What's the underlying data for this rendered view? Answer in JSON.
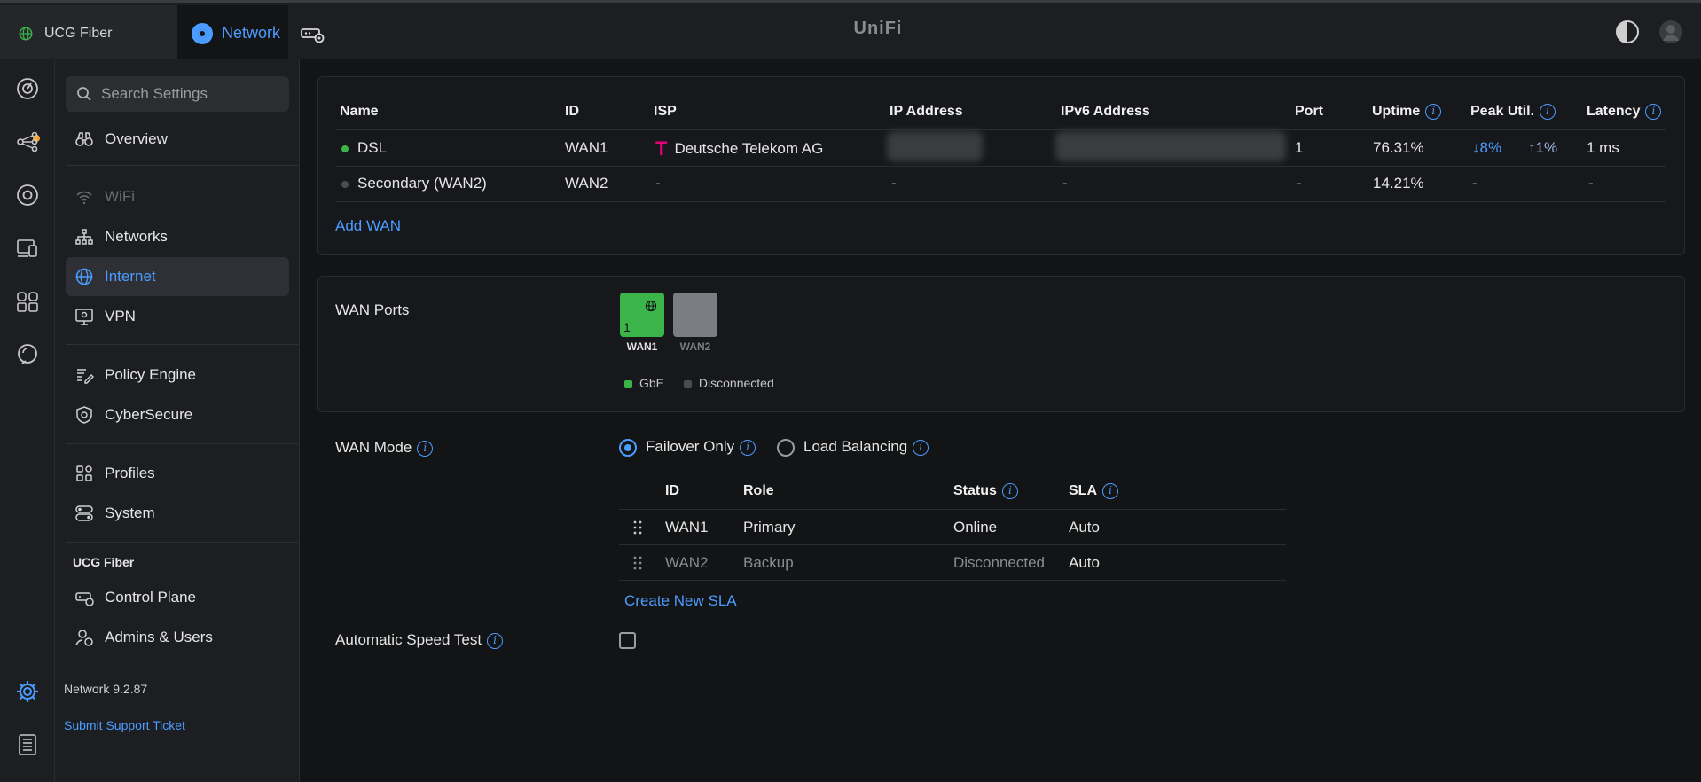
{
  "topbar": {
    "site_tab": "UCG Fiber",
    "app_tab": "Network",
    "brand": "UniFi"
  },
  "sidebar": {
    "search_placeholder": "Search Settings",
    "items": [
      {
        "label": "Overview",
        "icon": "binoculars-icon"
      },
      {
        "label": "WiFi",
        "icon": "wifi-icon",
        "disabled": true
      },
      {
        "label": "Networks",
        "icon": "network-tree-icon"
      },
      {
        "label": "Internet",
        "icon": "globe-icon",
        "active": true
      },
      {
        "label": "VPN",
        "icon": "vpn-icon"
      },
      {
        "label": "Policy Engine",
        "icon": "policy-icon"
      },
      {
        "label": "CyberSecure",
        "icon": "shield-icon"
      },
      {
        "label": "Profiles",
        "icon": "profiles-icon"
      },
      {
        "label": "System",
        "icon": "system-toggles-icon"
      }
    ],
    "section_label": "UCG Fiber",
    "device_items": [
      {
        "label": "Control Plane",
        "icon": "control-plane-icon"
      },
      {
        "label": "Admins & Users",
        "icon": "admins-icon"
      }
    ],
    "version": "Network 9.2.87",
    "support": "Submit Support Ticket"
  },
  "wan_table": {
    "headers": [
      "Name",
      "ID",
      "ISP",
      "IP Address",
      "IPv6 Address",
      "Port",
      "Uptime",
      "Peak Util.",
      "Latency"
    ],
    "rows": [
      {
        "name": "DSL",
        "status_color": "#3bb54a",
        "id": "WAN1",
        "isp": "Deutsche Telekom AG",
        "isp_logo": "T",
        "port": "1",
        "uptime": "76.31%",
        "peak_down": "↓8%",
        "peak_up": "↑1%",
        "latency": "1 ms"
      },
      {
        "name": "Secondary (WAN2)",
        "status_color": "#4a4c50",
        "id": "WAN2",
        "isp": "-",
        "ip": "-",
        "ipv6": "-",
        "port": "-",
        "uptime": "14.21%",
        "peak": "-",
        "latency": "-"
      }
    ],
    "add_wan": "Add WAN"
  },
  "wan_ports": {
    "label": "WAN Ports",
    "ports": [
      {
        "number": "1",
        "label": "WAN1",
        "color": "#3bb54a"
      },
      {
        "label": "WAN2",
        "color": "#7b7d82"
      }
    ],
    "legend": [
      {
        "label": "GbE",
        "color": "#3bb54a"
      },
      {
        "label": "Disconnected",
        "color": "#4a4c50"
      }
    ]
  },
  "wan_mode": {
    "label": "WAN Mode",
    "options": [
      {
        "label": "Failover Only",
        "selected": true
      },
      {
        "label": "Load Balancing",
        "selected": false
      }
    ],
    "table_headers": [
      "ID",
      "Role",
      "Status",
      "SLA"
    ],
    "rows": [
      {
        "id": "WAN1",
        "role": "Primary",
        "status": "Online",
        "sla": "Auto"
      },
      {
        "id": "WAN2",
        "role": "Backup",
        "status": "Disconnected",
        "sla": "Auto"
      }
    ],
    "create_sla": "Create New SLA"
  },
  "speed_test": {
    "label": "Automatic Speed Test",
    "checked": false
  },
  "colors": {
    "accent": "#4c9cff",
    "online": "#3bb54a",
    "telekom": "#e20074"
  }
}
